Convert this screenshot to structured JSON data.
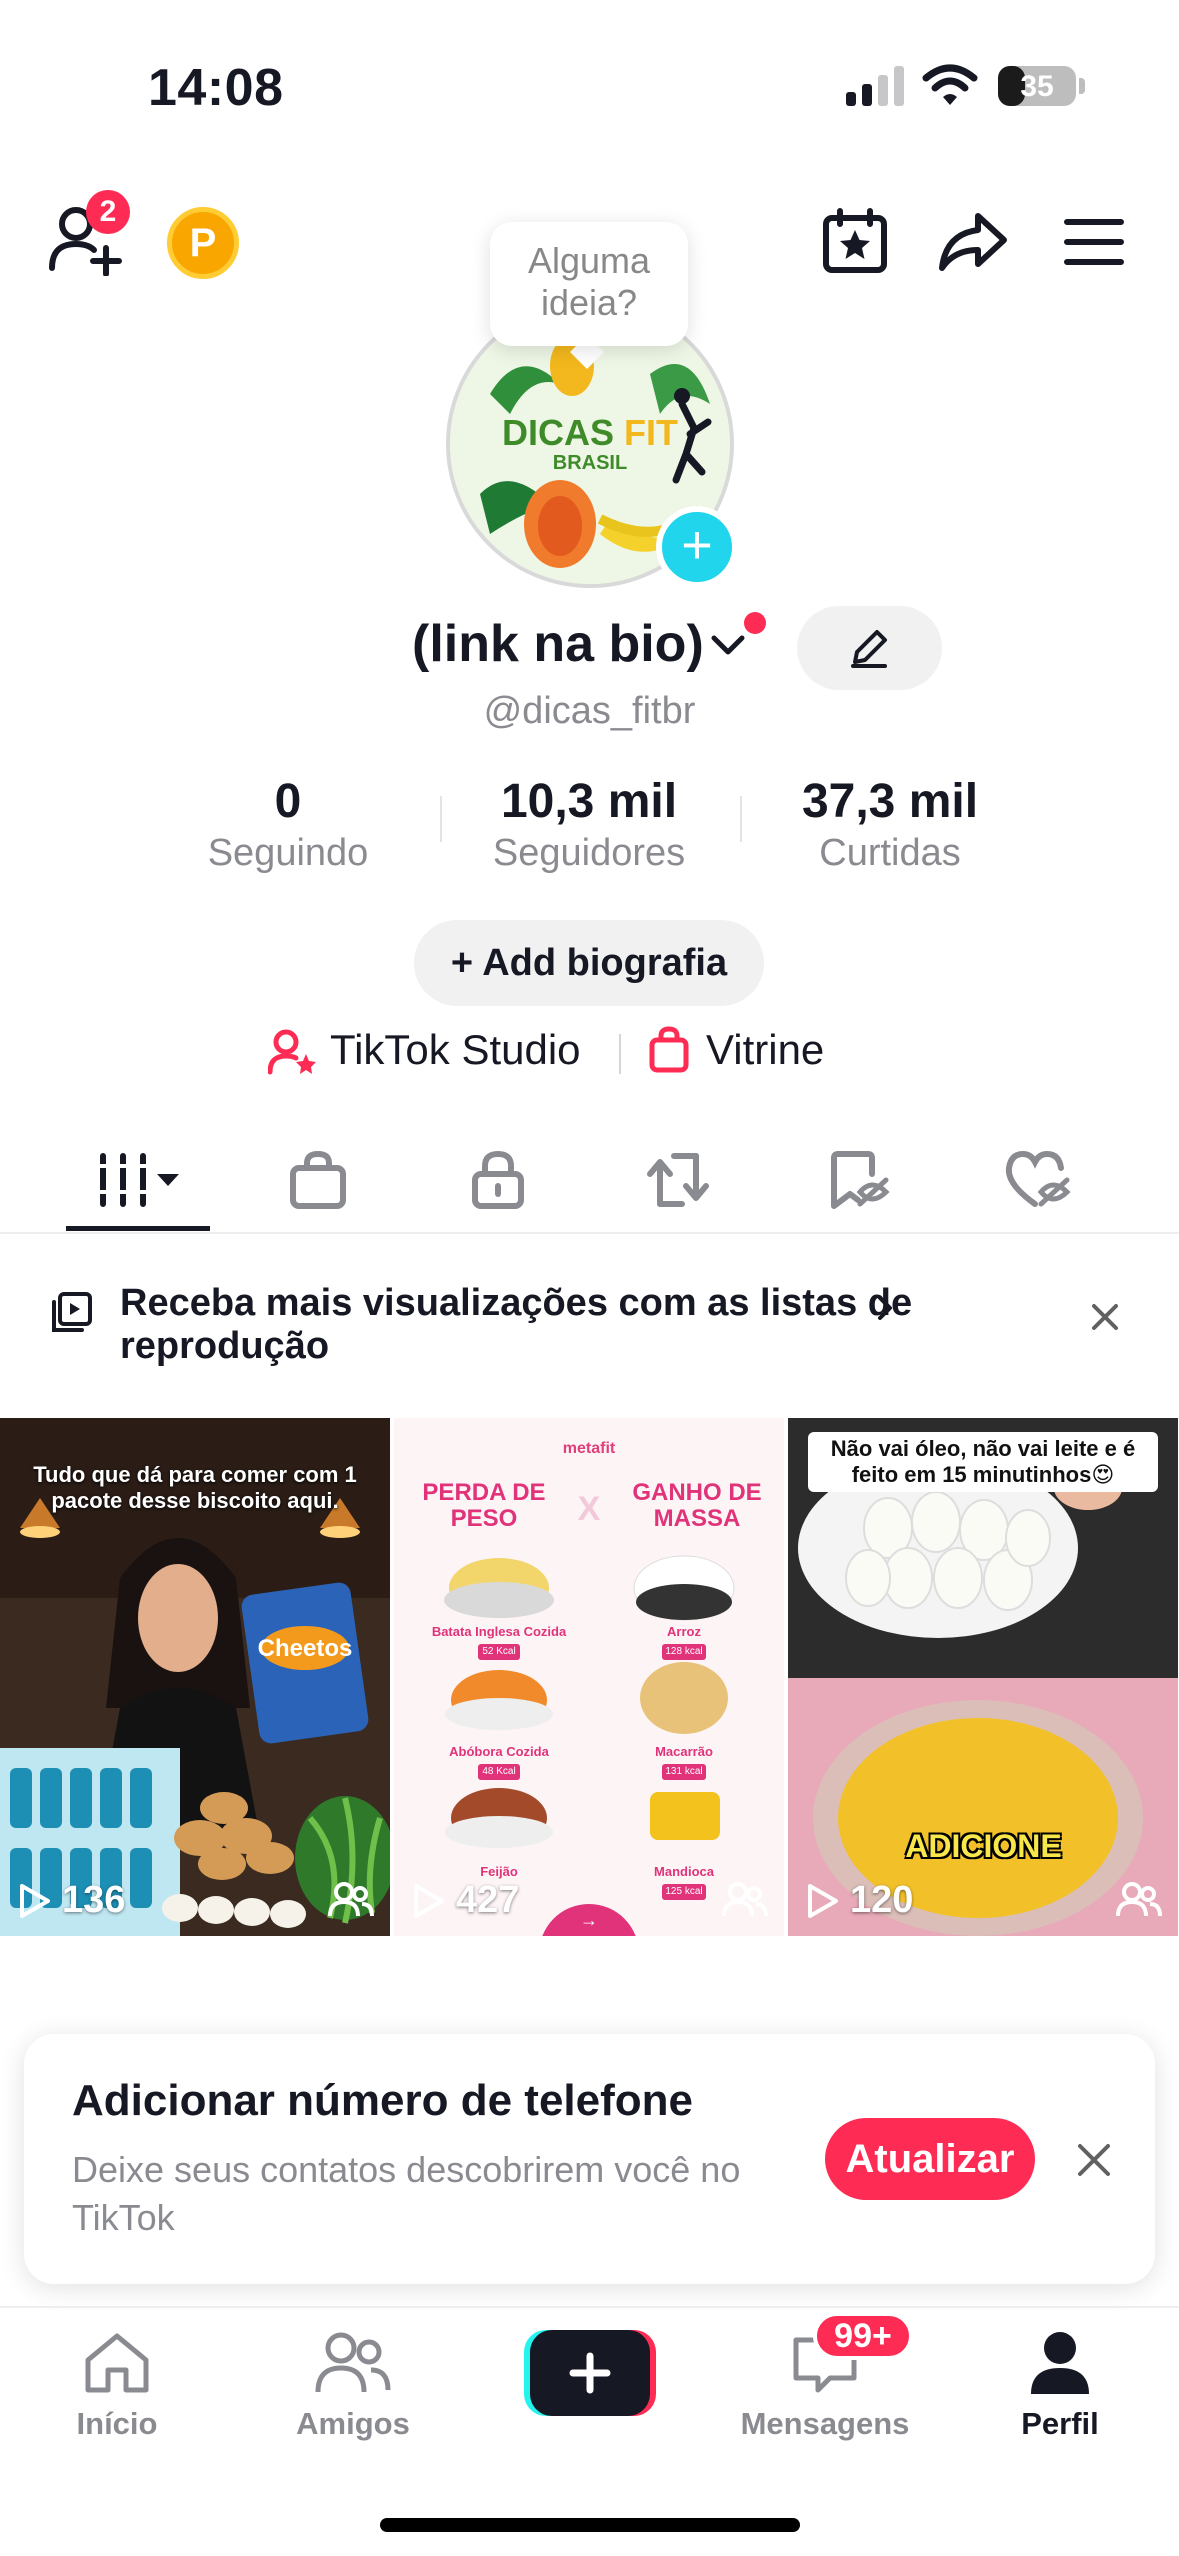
{
  "status_bar": {
    "time": "14:08",
    "battery": "35",
    "battery_level": 0.35
  },
  "header": {
    "notification_count": "2",
    "coin_label": "P",
    "tooltip": "Alguma ideia?",
    "avatar_text_main": "DICAS",
    "avatar_text_accent": "FIT",
    "avatar_text_sub": "BRASIL"
  },
  "profile": {
    "name": "(link na bio)",
    "handle": "@dicas_fitbr",
    "stats": [
      {
        "value": "0",
        "label": "Seguindo"
      },
      {
        "value": "10,3 mil",
        "label": "Seguidores"
      },
      {
        "value": "37,3 mil",
        "label": "Curtidas"
      }
    ],
    "bio_button": "Add biografia",
    "studio_link": "TikTok Studio",
    "shop_link": "Vitrine"
  },
  "promo": {
    "text": "Receba mais visualizações com as listas de reprodução"
  },
  "videos": [
    {
      "caption": "Tudo que dá para comer com 1 pacote desse biscoito aqui.",
      "views": "136",
      "brand": "Cheetos"
    },
    {
      "header_brand": "metafit",
      "left_title": "PERDA DE PESO",
      "right_title": "GANHO DE MASSA",
      "vs": "X",
      "foods": [
        {
          "name": "Batata Inglesa Cozida",
          "kcal": "52 Kcal"
        },
        {
          "name": "Arroz",
          "kcal": "128 kcal"
        },
        {
          "name": "Abóbora Cozida",
          "kcal": "48 Kcal"
        },
        {
          "name": "Macarrão",
          "kcal": "131 kcal"
        },
        {
          "name": "Feijão",
          "kcal": ""
        },
        {
          "name": "Mandioca",
          "kcal": "125 kcal"
        }
      ],
      "views": "427"
    },
    {
      "caption": "Não vai óleo, não vai leite e é feito em 15 minutinhos😍",
      "overlay": "ADICIONE",
      "views": "120"
    }
  ],
  "phone_card": {
    "title": "Adicionar número de telefone",
    "description": "Deixe seus contatos descobrirem você no TikTok",
    "button": "Atualizar"
  },
  "nav": {
    "items": [
      {
        "label": "Início"
      },
      {
        "label": "Amigos"
      },
      {
        "label": "Mensagens"
      },
      {
        "label": "Perfil"
      }
    ],
    "messages_badge": "99+"
  },
  "colors": {
    "accent": "#fe2c55",
    "cyan": "#20d5ec",
    "text": "#161823",
    "muted": "#8a8b91"
  }
}
